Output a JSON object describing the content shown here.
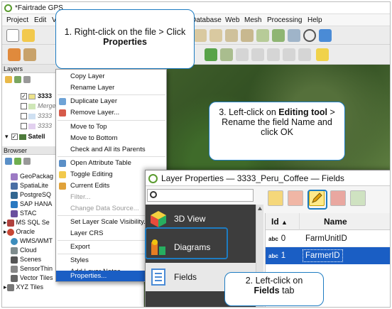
{
  "window": {
    "title": "*Fairtrade GPS"
  },
  "menubar": {
    "items": [
      "Project",
      "Edit",
      "V",
      "Database",
      "Web",
      "Mesh",
      "Processing",
      "Help"
    ]
  },
  "layers_panel": {
    "title": "Layers",
    "rows": [
      {
        "label": "3333",
        "checked": true,
        "bold": true
      },
      {
        "label": "Merge",
        "checked": false,
        "italic": true
      },
      {
        "label": "3333",
        "checked": false,
        "italic": true
      },
      {
        "label": "3333",
        "checked": false,
        "italic": true
      },
      {
        "label": "Satell",
        "checked": true,
        "bold": true
      }
    ]
  },
  "browser_panel": {
    "title": "Browser",
    "items": [
      "GeoPackag",
      "SpatiaLite",
      "PostgreSQ",
      "SAP HANA",
      "STAC",
      "MS SQL Se",
      "Oracle",
      "WMS/WMT",
      "Cloud",
      "Scenes",
      "SensorThin",
      "Vector Tiles",
      "XYZ Tiles"
    ]
  },
  "context_menu": {
    "items": [
      {
        "label": "Copy Layer",
        "enabled": true
      },
      {
        "label": "Rename Layer",
        "enabled": true
      },
      {
        "label": "Duplicate Layer",
        "enabled": true
      },
      {
        "label": "Remove Layer...",
        "enabled": true
      },
      {
        "label": "Move to Top",
        "enabled": true
      },
      {
        "label": "Move to Bottom",
        "enabled": true
      },
      {
        "label": "Check and All its Parents",
        "enabled": true
      },
      {
        "label": "Open Attribute Table",
        "enabled": true
      },
      {
        "label": "Toggle Editing",
        "enabled": true
      },
      {
        "label": "Current Edits",
        "enabled": true
      },
      {
        "label": "Filter...",
        "enabled": false
      },
      {
        "label": "Change Data Source...",
        "enabled": false
      },
      {
        "label": "Set Layer Scale Visibility...",
        "enabled": true
      },
      {
        "label": "Layer CRS",
        "enabled": true
      },
      {
        "label": "Export",
        "enabled": true
      },
      {
        "label": "Styles",
        "enabled": true
      },
      {
        "label": "Add Layer Notes...",
        "enabled": true
      },
      {
        "label": "Properties...",
        "enabled": true,
        "selected": true
      }
    ]
  },
  "dialog": {
    "title": "Layer Properties — 3333_Peru_Coffee — Fields",
    "search_placeholder": "",
    "sidebar": [
      "3D View",
      "Diagrams",
      "Fields"
    ],
    "active_tab": "Fields",
    "columns": [
      "Id",
      "Name"
    ],
    "rows": [
      {
        "type": "abc",
        "id": "0",
        "name": "FarmUnitID"
      },
      {
        "type": "abc",
        "id": "1",
        "name": "FarmerID"
      }
    ]
  },
  "callouts": {
    "step1_pre": "1. Right-click on the file > Click ",
    "step1_bold": "Properties",
    "step2_pre": "2. Left-click on",
    "step2_bold": "Fields",
    "step2_post": " tab",
    "step3_pre": "3. Left-click on ",
    "step3_bold": "Editing tool",
    "step3_post": " > Rename the field Name and click OK"
  },
  "colors": {
    "accent": "#1e7cc2",
    "selection": "#1a5ec4",
    "qgis_green": "#5a9b2f"
  }
}
